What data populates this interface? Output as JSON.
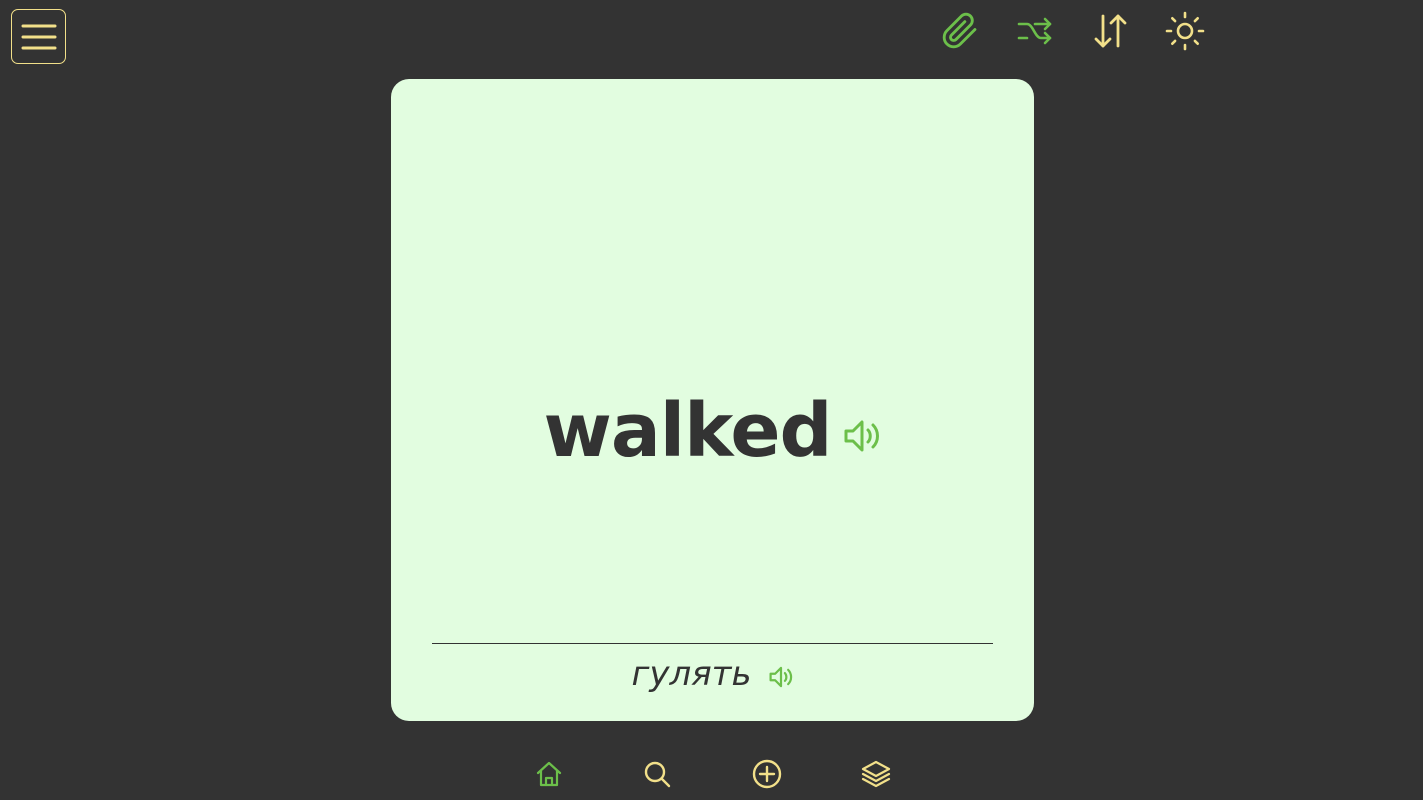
{
  "card": {
    "word": "walked",
    "translation": "гулять"
  },
  "icons": {
    "menu": "hamburger-menu-icon",
    "attach": "paperclip-icon",
    "shuffle": "shuffle-icon",
    "sort": "sort-arrows-icon",
    "theme": "sun-icon",
    "speaker": "speaker-icon",
    "home": "home-icon",
    "search": "search-icon",
    "add": "plus-circle-icon",
    "decks": "layers-icon"
  },
  "colors": {
    "background": "#333333",
    "card_background": "#e2fde0",
    "accent_green": "#6cbf4a",
    "accent_yellow": "#f2e08a",
    "text_dark": "#333333"
  }
}
